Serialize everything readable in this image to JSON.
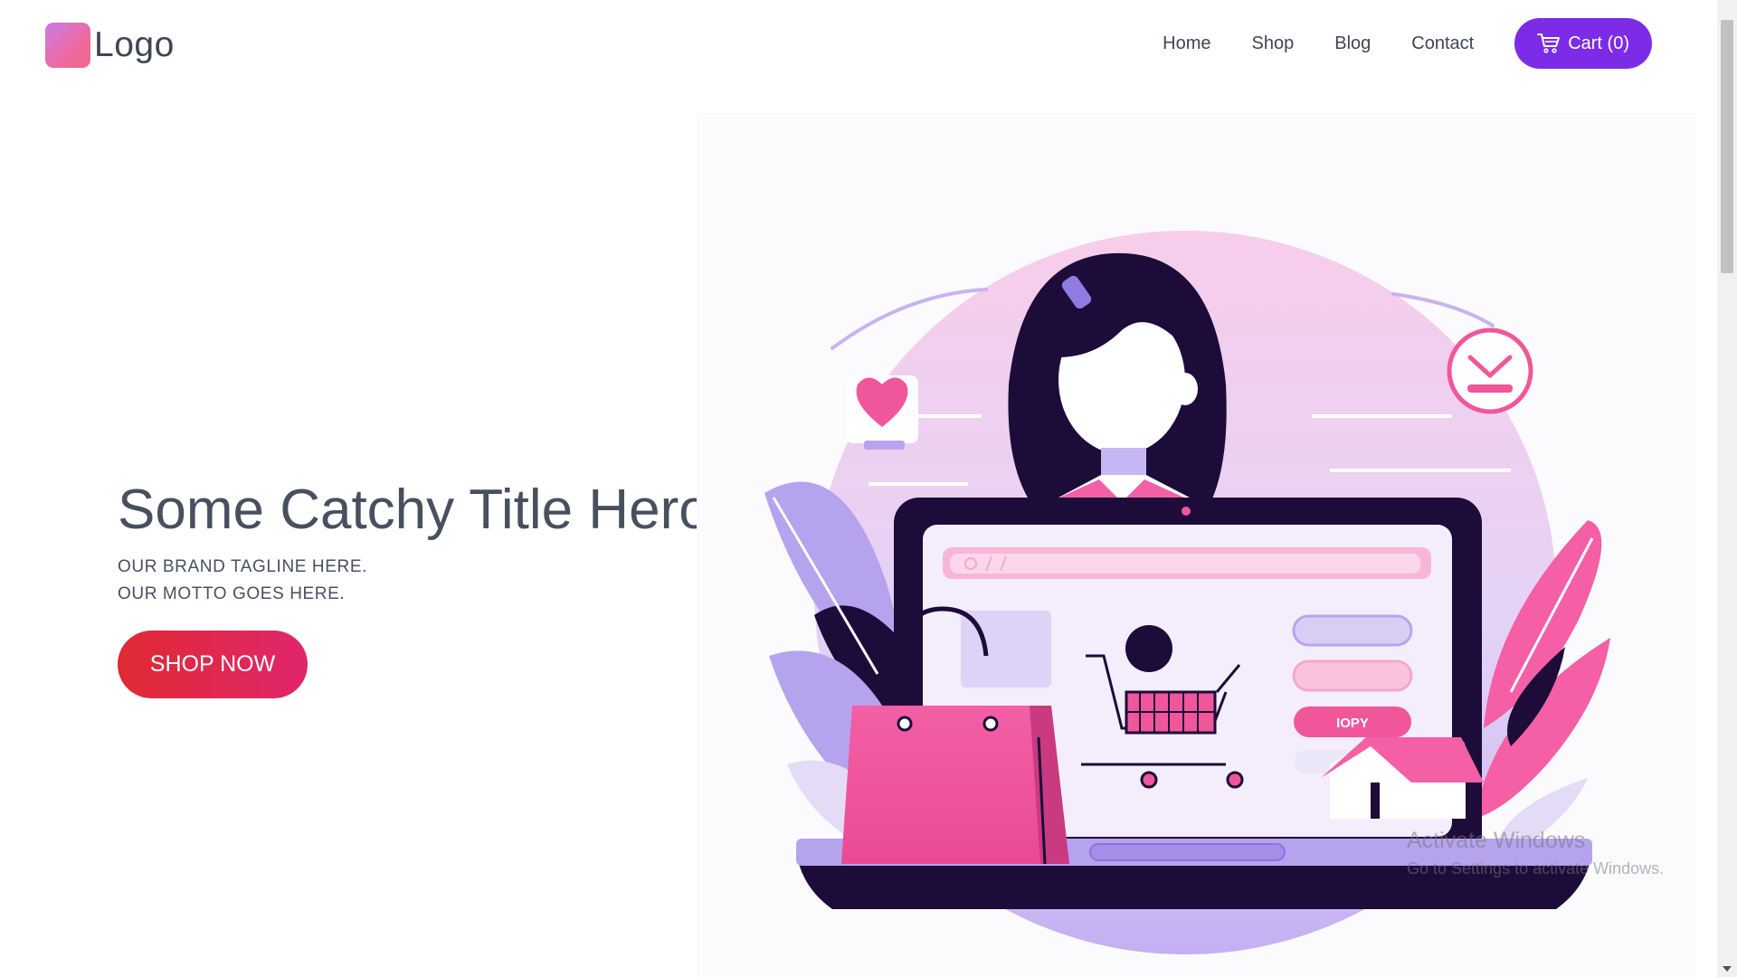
{
  "header": {
    "logo_text": "Logo",
    "nav": [
      {
        "label": "Home"
      },
      {
        "label": "Shop"
      },
      {
        "label": "Blog"
      },
      {
        "label": "Contact"
      }
    ],
    "cart_label": "Cart (0)"
  },
  "hero": {
    "title": "Some Catchy Title Hero",
    "tagline": "OUR BRAND TAGLINE HERE.",
    "motto": "OUR MOTTO GOES HERE.",
    "cta": "SHOP NOW"
  },
  "illustration": {
    "screen_button_label": "IOPY"
  },
  "watermark": {
    "title": "Activate Windows",
    "subtitle": "Go to Settings to activate Windows."
  },
  "colors": {
    "accent": "#7c2ce6",
    "cta_start": "#e02a32",
    "cta_end": "#e0266c",
    "text": "#48505f",
    "pink": "#f0569a",
    "lavender": "#b9a3f0",
    "navy": "#1d0b3a"
  },
  "icons": [
    "cart-icon",
    "heart-icon",
    "download-icon"
  ]
}
